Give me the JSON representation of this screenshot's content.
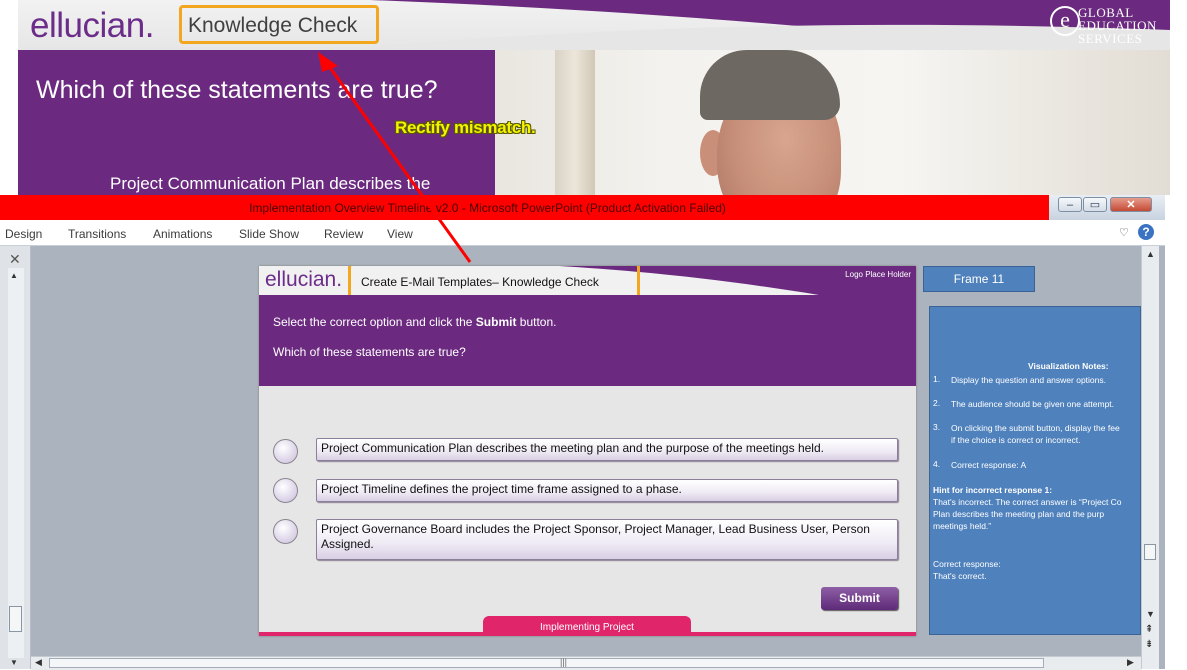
{
  "background_slide": {
    "logo": "ellucian.",
    "title": "Knowledge Check",
    "question": "Which of these statements are true?",
    "option_partial": "Project Communication Plan describes the",
    "brand": {
      "line1": "GLOBAL",
      "line2": "EDUCATION",
      "line3": "SERVICES",
      "icon_letter": "e"
    }
  },
  "annotation": {
    "label": "Rectify mismatch."
  },
  "window": {
    "title": "Implementation Overview Timeline v2.0  -  Microsoft PowerPoint (Product Activation Failed)",
    "minimize": "–",
    "maximize": "▭",
    "close": "✕"
  },
  "ribbon": {
    "tabs": [
      "Design",
      "Transitions",
      "Animations",
      "Slide Show",
      "Review",
      "View"
    ],
    "collapse": "♡",
    "help": "?"
  },
  "left_pane": {
    "close": "✕"
  },
  "slide": {
    "logo": "ellucian.",
    "title": "Create E-Mail Templates– Knowledge Check",
    "logo_placeholder": "Logo Place Holder",
    "instruction_pre": "Select the correct option and click the ",
    "instruction_bold": "Submit",
    "instruction_post": "  button.",
    "question": "Which of these statements are true?",
    "options": [
      "Project Communication Plan describes the meeting plan and the purpose of the meetings held.",
      "Project Timeline defines the project time frame assigned to a phase.",
      "Project Governance Board includes the  Project Sponsor, Project Manager,  Lead Business User, Person Assigned."
    ],
    "submit": "Submit",
    "footer": "Implementing Project"
  },
  "frame": {
    "label": "Frame 11"
  },
  "notes": {
    "heading": "Visualization  Notes:",
    "items": [
      {
        "num": "1.",
        "text": "Display the question and answer options."
      },
      {
        "num": "2.",
        "text": "The audience should  be given one attempt."
      },
      {
        "num": "3.",
        "text": "On clicking the submit button, display the fee"
      },
      {
        "num": "4.",
        "text": "Correct  response:  A"
      }
    ],
    "item3_line2": "if the choice  is correct  or incorrect.",
    "hint_heading": "Hint for incorrect response 1:",
    "hint_line1": "That's incorrect.  The correct answer is “Project Co",
    "hint_line2": "Plan describes the meeting plan and the purp",
    "hint_line3": "meetings held.”",
    "correct_heading": "Correct  response:",
    "correct_text": "That's correct."
  },
  "colors": {
    "purple": "#6b2a7f",
    "accent_orange": "#f2a71e",
    "titlebar_red": "#ff0000",
    "notes_blue": "#4f81bd",
    "footer_pink": "#e0256a"
  }
}
